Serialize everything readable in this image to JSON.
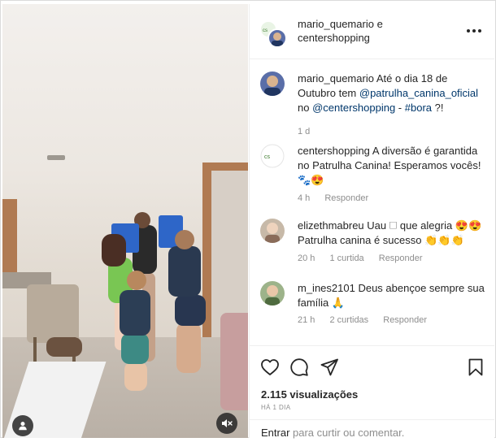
{
  "post": {
    "header": {
      "owner": "mario_quemario",
      "joiner": "e",
      "collaborator": "centershopping"
    },
    "comments": [
      {
        "user": "mario_quemario",
        "parts": [
          {
            "t": "Até o dia 18 de Outubro tem ",
            "m": false
          },
          {
            "t": "@patrulha_canina_oficial",
            "m": true
          },
          {
            "t": " no ",
            "m": false
          },
          {
            "t": "@centershopping",
            "m": true
          },
          {
            "t": " - ",
            "m": false
          },
          {
            "t": "#bora",
            "m": true
          },
          {
            "t": " ?!",
            "m": false
          }
        ],
        "time": "1 d",
        "likes": "",
        "reply": ""
      },
      {
        "user": "centershopping",
        "parts": [
          {
            "t": "A diversão é garantida no Patrulha Canina! Esperamos vocês! 🐾😍",
            "m": false
          }
        ],
        "time": "4 h",
        "likes": "",
        "reply": "Responder"
      },
      {
        "user": "elizethmabreu",
        "parts": [
          {
            "t": "Uau 🗆 que alegria 😍😍 Patrulha canina é sucesso 👏👏👏",
            "m": false
          }
        ],
        "time": "20 h",
        "likes": "1 curtida",
        "reply": "Responder"
      },
      {
        "user": "m_ines2101",
        "parts": [
          {
            "t": "Deus abençoe sempre sua família 🙏",
            "m": false
          }
        ],
        "time": "21 h",
        "likes": "2 curtidas",
        "reply": "Responder"
      }
    ],
    "views": "2.115 visualizações",
    "date": "HÁ 1 DIA",
    "login_link": "Entrar",
    "login_rest": " para curtir ou comentar."
  },
  "colors": {
    "text": "#262626",
    "muted": "#8e8e8e",
    "mention": "#00376b",
    "border": "#efefef"
  },
  "icons": {
    "more": "more-options-icon",
    "like": "heart-icon",
    "comment": "comment-bubble-icon",
    "share": "paper-plane-icon",
    "save": "bookmark-icon",
    "tag": "user-tag-icon",
    "mute": "speaker-muted-icon"
  }
}
